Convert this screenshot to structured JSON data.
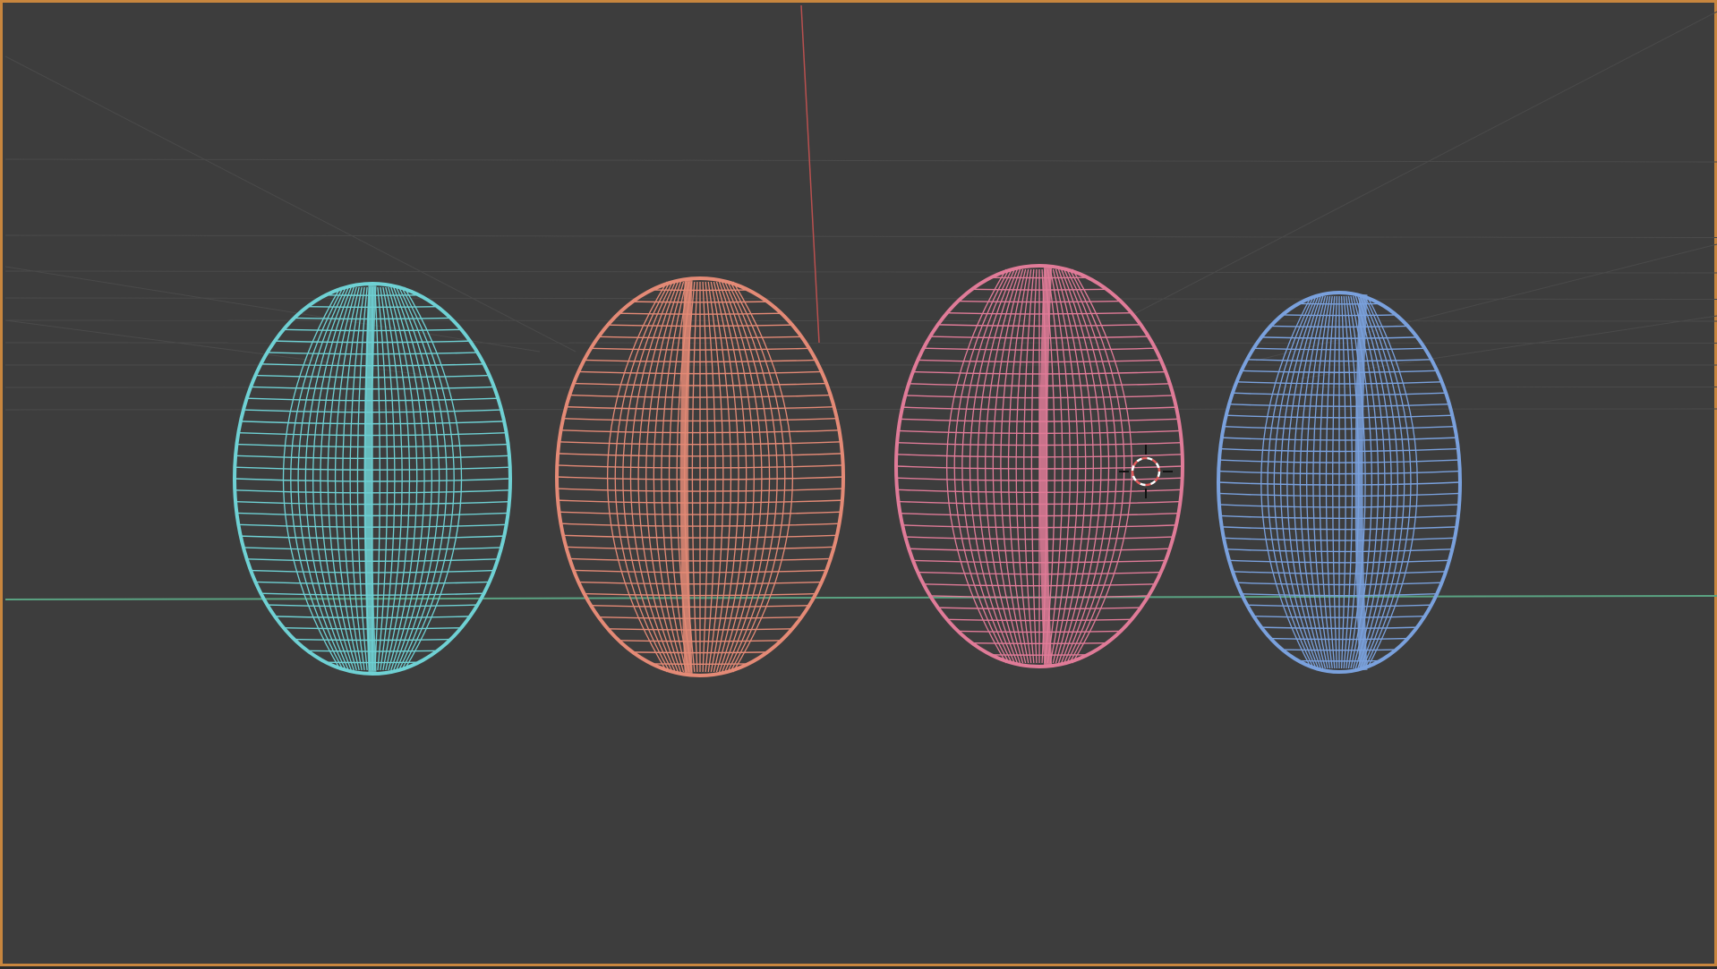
{
  "viewport": {
    "background_color": "#3d3d3d",
    "frame_color": "#c8863e",
    "view_mode": "wireframe"
  },
  "axes": {
    "x_axis_color": "#5aa382",
    "z_axis_color": "#b9504f",
    "grid_color": "#4a4a4a"
  },
  "objects": [
    {
      "id": "bean-1",
      "color": "#6fd1d4"
    },
    {
      "id": "bean-2",
      "color": "#e48a76"
    },
    {
      "id": "bean-3",
      "color": "#e07b98"
    },
    {
      "id": "bean-4",
      "color": "#7aa1dd"
    }
  ],
  "cursor": {
    "icon": "3d-cursor-icon",
    "color_a": "#e05a5a",
    "color_b": "#ffffff"
  }
}
